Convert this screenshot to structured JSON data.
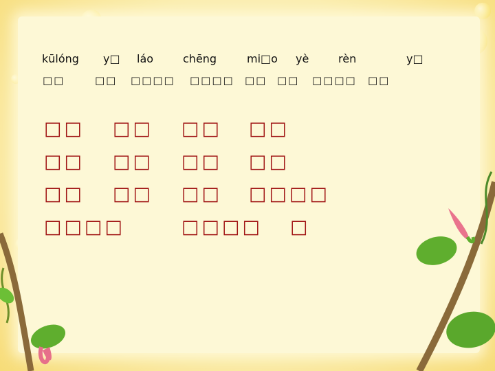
{
  "pinyin": [
    "kūlóng",
    "y□",
    "láo",
    "chēng",
    "mi□o",
    "yè",
    "rèn",
    "y□"
  ],
  "small_chars": [
    "□□",
    "□□",
    "□□□□",
    "□□□□",
    "□□",
    "□□",
    "□□□□",
    "□□"
  ],
  "rows": [
    [
      "□□",
      "□□",
      "□□",
      "□□"
    ],
    [
      "□□",
      "□□",
      "□□",
      "□□"
    ],
    [
      "□□",
      "□□",
      "□□",
      "□□□□"
    ],
    [
      "□□□□",
      "□□□□",
      "□"
    ]
  ],
  "colors": {
    "background": "#f9e38a",
    "panel": "#fdf8d6",
    "red_text": "#a01414"
  }
}
